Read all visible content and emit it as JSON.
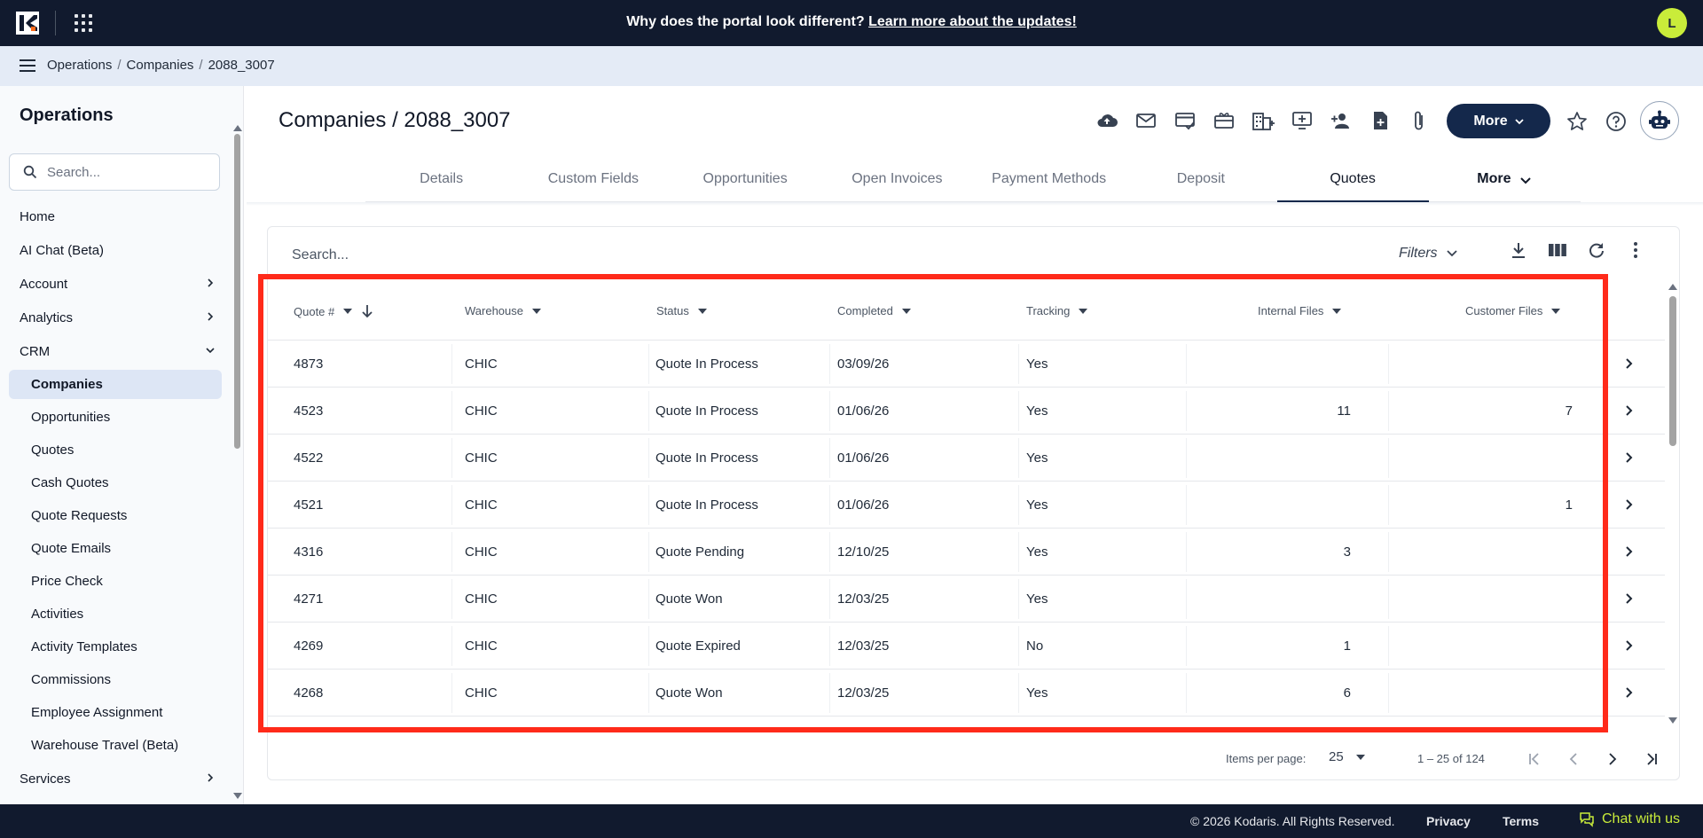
{
  "banner": {
    "text": "Why does the portal look different?",
    "link": "Learn more about the updates!"
  },
  "user": {
    "avatar_initial": "L"
  },
  "breadcrumb": [
    "Operations",
    "Companies",
    "2088_3007"
  ],
  "sidebar": {
    "title": "Operations",
    "search_placeholder": "Search...",
    "items": [
      {
        "label": "Home"
      },
      {
        "label": "AI Chat (Beta)"
      },
      {
        "label": "Account",
        "chevron": "right"
      },
      {
        "label": "Analytics",
        "chevron": "right"
      },
      {
        "label": "CRM",
        "chevron": "down"
      }
    ],
    "crm_items": [
      {
        "label": "Companies",
        "active": true
      },
      {
        "label": "Opportunities"
      },
      {
        "label": "Quotes"
      },
      {
        "label": "Cash Quotes"
      },
      {
        "label": "Quote Requests"
      },
      {
        "label": "Quote Emails"
      },
      {
        "label": "Price Check"
      },
      {
        "label": "Activities"
      },
      {
        "label": "Activity Templates"
      },
      {
        "label": "Commissions"
      },
      {
        "label": "Employee Assignment"
      },
      {
        "label": "Warehouse Travel (Beta)"
      }
    ],
    "services": {
      "label": "Services"
    }
  },
  "page": {
    "title": "Companies / 2088_3007",
    "more_label": "More",
    "toolbar_icons": [
      "cloud-upload-icon",
      "mail-icon",
      "card-check-icon",
      "gift-card-icon",
      "building-icon",
      "add-screen-icon",
      "add-person-icon",
      "add-document-icon",
      "attachment-icon"
    ]
  },
  "tabs": [
    {
      "label": "Details"
    },
    {
      "label": "Custom Fields"
    },
    {
      "label": "Opportunities"
    },
    {
      "label": "Open Invoices"
    },
    {
      "label": "Payment Methods"
    },
    {
      "label": "Deposit"
    },
    {
      "label": "Quotes",
      "active": true
    },
    {
      "label": "More"
    }
  ],
  "table": {
    "search_placeholder": "Search...",
    "filters_label": "Filters",
    "columns": {
      "quote": "Quote #",
      "warehouse": "Warehouse",
      "status": "Status",
      "completed": "Completed",
      "tracking": "Tracking",
      "internal_files": "Internal Files",
      "customer_files": "Customer Files"
    },
    "rows": [
      {
        "quote": "4873",
        "warehouse": "CHIC",
        "status": "Quote In Process",
        "completed": "03/09/26",
        "tracking": "Yes",
        "internal_files": "",
        "customer_files": ""
      },
      {
        "quote": "4523",
        "warehouse": "CHIC",
        "status": "Quote In Process",
        "completed": "01/06/26",
        "tracking": "Yes",
        "internal_files": "11",
        "customer_files": "7"
      },
      {
        "quote": "4522",
        "warehouse": "CHIC",
        "status": "Quote In Process",
        "completed": "01/06/26",
        "tracking": "Yes",
        "internal_files": "",
        "customer_files": ""
      },
      {
        "quote": "4521",
        "warehouse": "CHIC",
        "status": "Quote In Process",
        "completed": "01/06/26",
        "tracking": "Yes",
        "internal_files": "",
        "customer_files": "1"
      },
      {
        "quote": "4316",
        "warehouse": "CHIC",
        "status": "Quote Pending",
        "completed": "12/10/25",
        "tracking": "Yes",
        "internal_files": "3",
        "customer_files": ""
      },
      {
        "quote": "4271",
        "warehouse": "CHIC",
        "status": "Quote Won",
        "completed": "12/03/25",
        "tracking": "Yes",
        "internal_files": "",
        "customer_files": ""
      },
      {
        "quote": "4269",
        "warehouse": "CHIC",
        "status": "Quote Expired",
        "completed": "12/03/25",
        "tracking": "No",
        "internal_files": "1",
        "customer_files": ""
      },
      {
        "quote": "4268",
        "warehouse": "CHIC",
        "status": "Quote Won",
        "completed": "12/03/25",
        "tracking": "Yes",
        "internal_files": "6",
        "customer_files": ""
      }
    ],
    "pagination": {
      "items_per_page_label": "Items per page:",
      "items_per_page": "25",
      "range": "1 – 25 of 124"
    }
  },
  "footer": {
    "copyright": "© 2026 Kodaris. All Rights Reserved.",
    "privacy": "Privacy",
    "terms": "Terms",
    "chat": "Chat with us"
  },
  "colors": {
    "navy": "#111a2e",
    "accent": "#14284b",
    "lime": "#c9ec3a",
    "highlight": "#ff2a1a"
  }
}
